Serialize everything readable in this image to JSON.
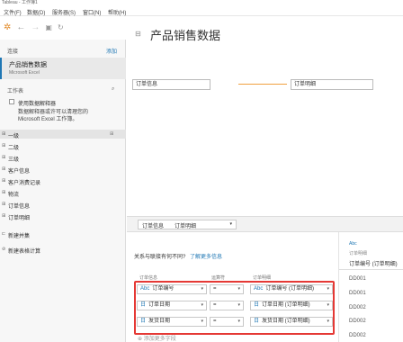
{
  "window": {
    "title": "Tableau - 工作簿1"
  },
  "menu": [
    "文件(F)",
    "数据(D)",
    "服务器(S)",
    "窗口(N)",
    "帮助(H)"
  ],
  "toolbar": {
    "icons": [
      "tableau-logo-icon",
      "back-icon",
      "forward-icon",
      "save-icon",
      "refresh-icon"
    ]
  },
  "connections": {
    "header": "连接",
    "add_link": "添加",
    "item_name": "产品销售数据",
    "item_type": "Microsoft Excel"
  },
  "sheets": {
    "header": "工作表",
    "interpreter_label": "使用数据解释器",
    "interpreter_desc_1": "数据解释器或许可以清理您的",
    "interpreter_desc_2": "Microsoft Excel 工作簿。",
    "items": [
      "一级",
      "二级",
      "三级",
      "客户信息",
      "客户消费记录",
      "物流",
      "订单信息",
      "订单明细"
    ],
    "new_union": "新建并集",
    "new_table_calc": "新建表格计算"
  },
  "canvas": {
    "title": "产品销售数据",
    "left_table": "订单信息",
    "right_table": "订单明细"
  },
  "tabs": {
    "tab1": "订单信息",
    "tab2": "订单明细"
  },
  "join": {
    "question": "关系与联接有何不同?",
    "learn_more": "了解更多信息",
    "col_left": "订单信息",
    "col_op": "运算符",
    "col_right": "订单明细",
    "rows": [
      {
        "left": "订单编号",
        "op": "=",
        "right": "订单编号 (订单明细)",
        "icon": "Abc"
      },
      {
        "left": "订单日期",
        "op": "=",
        "right": "订单日期 (订单明细)",
        "icon": "日"
      },
      {
        "left": "发货日期",
        "op": "=",
        "right": "发货日期 (订单明细)",
        "icon": "日"
      }
    ],
    "add_clause": "添加更多字段"
  },
  "datagrid": {
    "type_label": "Abc",
    "table_name": "订单明细",
    "field_header": "订单编号 (订单明细)",
    "values": [
      "DD001",
      "DD001",
      "DD002",
      "DD002",
      "DD002"
    ]
  },
  "colors": {
    "accent": "#1f77b4",
    "join_line": "#f0a040",
    "highlight": "#e53935"
  }
}
